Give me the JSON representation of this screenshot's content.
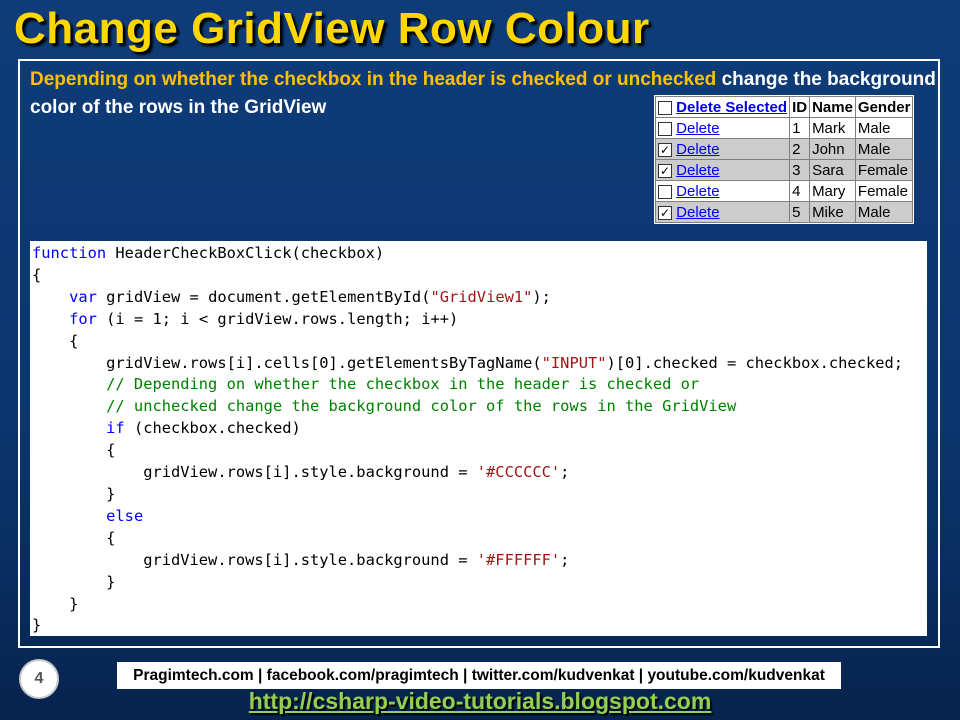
{
  "slide": {
    "title": "Change GridView Row Colour",
    "description_highlight": "Depending on whether the checkbox in the header is checked or unchecked",
    "description_rest": " change the background color of the rows in the GridView",
    "page_number": "4"
  },
  "gridview": {
    "headers": [
      "Delete Selected",
      "ID",
      "Name",
      "Gender"
    ],
    "header_checked": false,
    "rows": [
      {
        "checked": false,
        "action": "Delete",
        "id": "1",
        "name": "Mark",
        "gender": "Male"
      },
      {
        "checked": true,
        "action": "Delete",
        "id": "2",
        "name": "John",
        "gender": "Male"
      },
      {
        "checked": true,
        "action": "Delete",
        "id": "3",
        "name": "Sara",
        "gender": "Female"
      },
      {
        "checked": false,
        "action": "Delete",
        "id": "4",
        "name": "Mary",
        "gender": "Female"
      },
      {
        "checked": true,
        "action": "Delete",
        "id": "5",
        "name": "Mike",
        "gender": "Male"
      }
    ],
    "checked_row_color": "#CCCCCC",
    "unchecked_row_color": "#FFFFFF"
  },
  "code": {
    "lines": [
      [
        [
          "kw",
          "function"
        ],
        [
          "t",
          " HeaderCheckBoxClick(checkbox)"
        ]
      ],
      [
        [
          "t",
          "{"
        ]
      ],
      [
        [
          "t",
          "    "
        ],
        [
          "kw",
          "var"
        ],
        [
          "t",
          " gridView = document.getElementById("
        ],
        [
          "st",
          "\"GridView1\""
        ],
        [
          "t",
          ");"
        ]
      ],
      [
        [
          "t",
          "    "
        ],
        [
          "kw",
          "for"
        ],
        [
          "t",
          " (i = 1; i < gridView.rows.length; i++)"
        ]
      ],
      [
        [
          "t",
          "    {"
        ]
      ],
      [
        [
          "t",
          "        gridView.rows[i].cells[0].getElementsByTagName("
        ],
        [
          "st",
          "\"INPUT\""
        ],
        [
          "t",
          ")[0].checked = checkbox.checked;"
        ]
      ],
      [
        [
          "cm",
          "        // Depending on whether the checkbox in the header is checked or"
        ]
      ],
      [
        [
          "cm",
          "        // unchecked change the background color of the rows in the GridView"
        ]
      ],
      [
        [
          "t",
          "        "
        ],
        [
          "kw",
          "if"
        ],
        [
          "t",
          " (checkbox.checked)"
        ]
      ],
      [
        [
          "t",
          "        {"
        ]
      ],
      [
        [
          "t",
          "            gridView.rows[i].style.background = "
        ],
        [
          "st",
          "'#CCCCCC'"
        ],
        [
          "t",
          ";"
        ]
      ],
      [
        [
          "t",
          "        }"
        ]
      ],
      [
        [
          "t",
          "        "
        ],
        [
          "kw",
          "else"
        ]
      ],
      [
        [
          "t",
          "        {"
        ]
      ],
      [
        [
          "t",
          "            gridView.rows[i].style.background = "
        ],
        [
          "st",
          "'#FFFFFF'"
        ],
        [
          "t",
          ";"
        ]
      ],
      [
        [
          "t",
          "        }"
        ]
      ],
      [
        [
          "t",
          "    }"
        ]
      ],
      [
        [
          "t",
          "}"
        ]
      ]
    ]
  },
  "footer": {
    "social": "Pragimtech.com | facebook.com/pragimtech | twitter.com/kudvenkat | youtube.com/kudvenkat",
    "blog_url": "http://csharp-video-tutorials.blogspot.com"
  },
  "colors": {
    "title": "#FFD700",
    "highlight": "#FFC000",
    "blog_link": "#92D050",
    "background": "#0C3670"
  }
}
